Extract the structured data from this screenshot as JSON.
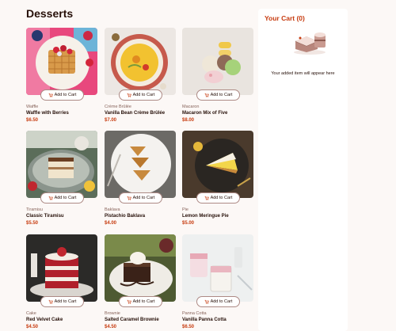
{
  "page": {
    "title": "Desserts"
  },
  "products": [
    {
      "category": "Waffle",
      "name": "Waffle with Berries",
      "price": "$6.50",
      "button": "Add to Cart",
      "image": "waffle-photo"
    },
    {
      "category": "Crème Brûlée",
      "name": "Vanilla Bean Crème Brûlée",
      "price": "$7.00",
      "button": "Add to Cart",
      "image": "creme-brulee-photo"
    },
    {
      "category": "Macaron",
      "name": "Macaron Mix of Five",
      "price": "$8.00",
      "button": "Add to Cart",
      "image": "macaron-photo"
    },
    {
      "category": "Tiramisu",
      "name": "Classic Tiramisu",
      "price": "$5.50",
      "button": "Add to Cart",
      "image": "tiramisu-photo"
    },
    {
      "category": "Baklava",
      "name": "Pistachio Baklava",
      "price": "$4.00",
      "button": "Add to Cart",
      "image": "baklava-photo"
    },
    {
      "category": "Pie",
      "name": "Lemon Meringue Pie",
      "price": "$5.00",
      "button": "Add to Cart",
      "image": "pie-photo"
    },
    {
      "category": "Cake",
      "name": "Red Velvet Cake",
      "price": "$4.50",
      "button": "Add to Cart",
      "image": "cake-photo"
    },
    {
      "category": "Brownie",
      "name": "Salted Caramel Brownie",
      "price": "$4.50",
      "button": "Add to Cart",
      "image": "brownie-photo"
    },
    {
      "category": "Panna Cotta",
      "name": "Vanilla Panna Cotta",
      "price": "$6.50",
      "button": "Add to Cart",
      "image": "panna-cotta-photo"
    }
  ],
  "cart": {
    "title": "Your Cart (0)",
    "empty_message": "Your added item will appear here",
    "illustration": "empty-cart-cake-illustration"
  },
  "colors": {
    "background": "#fcf8f6",
    "accent": "#c73b0f",
    "text": "#260f08",
    "muted": "#87635a"
  }
}
